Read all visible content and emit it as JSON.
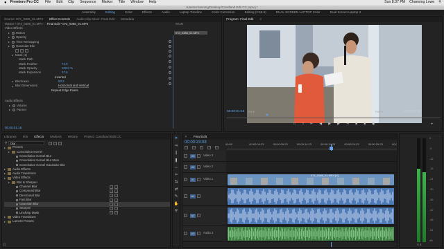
{
  "menubar": {
    "apple": "",
    "app": "Premiere Pro CC",
    "items": [
      "File",
      "Edit",
      "Clip",
      "Sequence",
      "Marker",
      "Title",
      "Window",
      "Help"
    ],
    "clock": "Sun 8:37 PM",
    "user": "Channing Lowe"
  },
  "pathbar": {
    "path": "/Users/channing/Desktop/Candland Edit CC.prproj *"
  },
  "workspaces": [
    "Assembly",
    "Editing",
    "Color",
    "Effects",
    "Audio",
    "Laptop Timeline",
    "Color Correction",
    "Editing (CS5.5)",
    "DUAL SCREEN LAPTOP Color",
    "Dual Screen Laptop 3"
  ],
  "effect_controls": {
    "tabs": [
      "Source: 072_0386_01.MP4",
      "Effect Controls",
      "Audio Clip Mixer: Final Edit",
      "Metadata"
    ],
    "header": "Master * 072_0386_01.MP4",
    "seq": "Final Edit * 072_0386_01.MP4",
    "clip_label": "072_0386_01.MP4",
    "ruler_time": "00:00",
    "section_video": "Video Effects",
    "rows": [
      {
        "label": "Motion",
        "value": "",
        "indent": 1
      },
      {
        "label": "Opacity",
        "value": "",
        "indent": 1
      },
      {
        "label": "Time Remapping",
        "value": "",
        "indent": 1
      },
      {
        "label": "Gaussian Blur",
        "value": "",
        "indent": 1
      },
      {
        "label": "",
        "value": "",
        "indent": 2
      },
      {
        "label": "Mask (1)",
        "value": "",
        "indent": 2
      },
      {
        "label": "Mask Path",
        "value": "",
        "indent": 3
      },
      {
        "label": "Mask Feather",
        "value": "72.0",
        "indent": 3
      },
      {
        "label": "Mask Opacity",
        "value": "100.0 %",
        "indent": 3
      },
      {
        "label": "Mask Expansion",
        "value": "37.6",
        "indent": 3
      },
      {
        "label": "",
        "value": "Inverted",
        "indent": 3
      },
      {
        "label": "Blurriness",
        "value": "93.2",
        "indent": 2
      },
      {
        "label": "Blur Dimensions",
        "value": "Horizontal and Vertical",
        "indent": 2
      },
      {
        "label": "",
        "value": "Repeat Edge Pixels",
        "indent": 2
      }
    ],
    "section_audio": "Audio Effects",
    "audio_rows": [
      "Volume",
      "Panner"
    ],
    "timecode": "00:00:01:18"
  },
  "program": {
    "tab_label": "Program: Final Edit",
    "tab_menu": "≡",
    "timecode_left": "00:00:01:18",
    "fit": "Fit",
    "quality": "Full",
    "timecode_right": "00:03:52:19"
  },
  "effects_panel": {
    "tabs": [
      "Libraries",
      "Info",
      "Effects",
      "Markers",
      "History",
      "Project: Candland Edit CC"
    ],
    "search": "blur",
    "items": [
      {
        "label": "Presets",
        "indent": 0,
        "kind": "folder"
      },
      {
        "label": "Convolution Kernel",
        "indent": 1,
        "kind": "folder"
      },
      {
        "label": "Convolution Kernel Blur",
        "indent": 2,
        "kind": "item"
      },
      {
        "label": "Convolution Kernel Blur More",
        "indent": 2,
        "kind": "item"
      },
      {
        "label": "Convolution Kernel Gaussian Blur",
        "indent": 2,
        "kind": "item"
      },
      {
        "label": "Audio Effects",
        "indent": 0,
        "kind": "folder"
      },
      {
        "label": "Audio Transitions",
        "indent": 0,
        "kind": "folder"
      },
      {
        "label": "Video Effects",
        "indent": 0,
        "kind": "folder"
      },
      {
        "label": "Blur & Sharpen",
        "indent": 1,
        "kind": "folder"
      },
      {
        "label": "Channel Blur",
        "indent": 2,
        "kind": "item"
      },
      {
        "label": "Compound Blur",
        "indent": 2,
        "kind": "item"
      },
      {
        "label": "Directional Blur",
        "indent": 2,
        "kind": "item"
      },
      {
        "label": "Fast Blur",
        "indent": 2,
        "kind": "item"
      },
      {
        "label": "Gaussian Blur",
        "indent": 2,
        "kind": "item"
      },
      {
        "label": "Sharpen",
        "indent": 2,
        "kind": "item"
      },
      {
        "label": "Unsharp Mask",
        "indent": 2,
        "kind": "item"
      },
      {
        "label": "Video Transitions",
        "indent": 0,
        "kind": "folder"
      },
      {
        "label": "Lumetri Presets",
        "indent": 0,
        "kind": "folder"
      }
    ]
  },
  "timeline": {
    "tab": "Final Edit",
    "timecode": "00:00:23:08",
    "ruler": [
      "00:00",
      "00:00:04:23",
      "00:00:09:23",
      "00:00:14:23",
      "00:00:19:23",
      "00:00:24:23",
      "00:00:29:23",
      "00:00:34:23"
    ],
    "tracks": [
      {
        "id": "V3",
        "name": "Video 3",
        "type": "video"
      },
      {
        "id": "V2",
        "name": "Video 2",
        "type": "video"
      },
      {
        "id": "V1",
        "name": "Video 1",
        "type": "video"
      },
      {
        "id": "A1",
        "name": "",
        "type": "audio"
      },
      {
        "id": "A2",
        "name": "",
        "type": "audio"
      },
      {
        "id": "A3",
        "name": "Audio 3",
        "type": "audio"
      }
    ],
    "clip_v1": "072_0386_01.MP4 [V]"
  },
  "meter": {
    "scale": [
      "0",
      "-6",
      "-12",
      "-18",
      "-24",
      "-30",
      "-36",
      "-42",
      "-48",
      "-54",
      "dB"
    ]
  }
}
